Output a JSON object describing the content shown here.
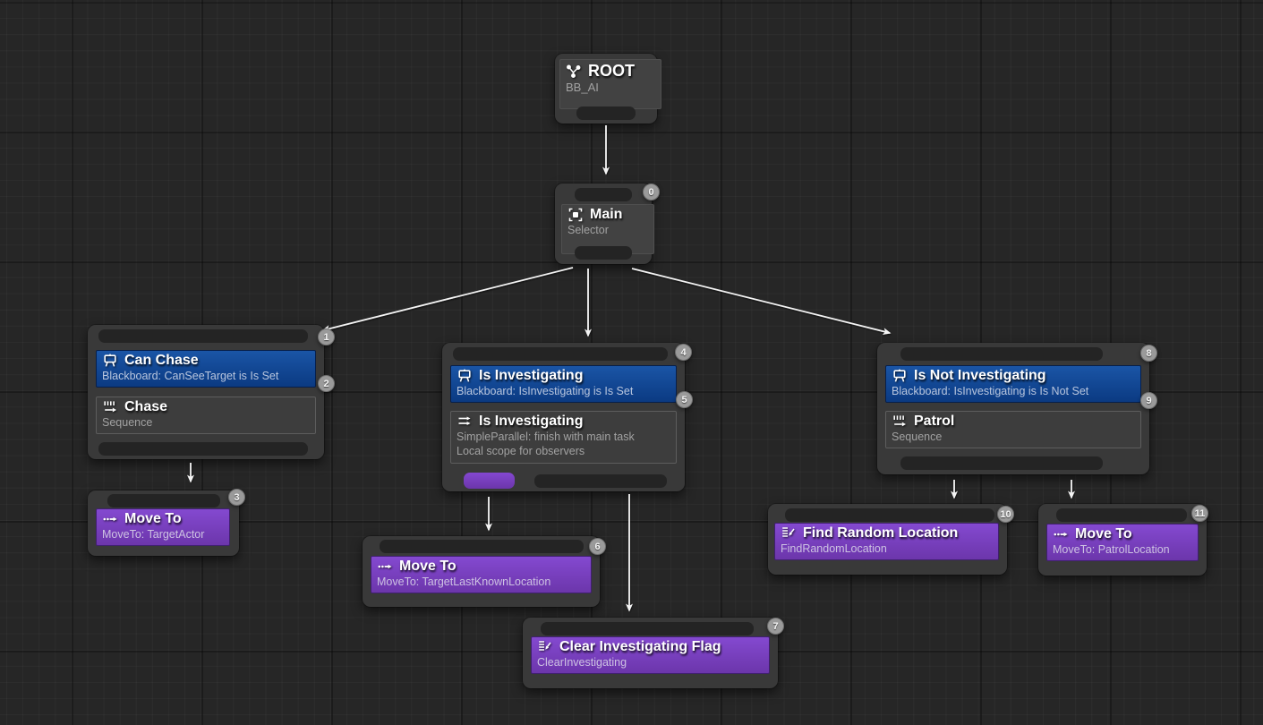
{
  "colors": {
    "background": "#262626",
    "node_gray": "#393939",
    "decorator_blue": "#11479a",
    "task_purple": "#7a3fc4",
    "wire": "#f2f2f2",
    "badge": "#9a9a9a"
  },
  "nodes": {
    "root": {
      "title": "ROOT",
      "subtitle": "BB_AI"
    },
    "main": {
      "badge": "0",
      "title": "Main",
      "subtitle": "Selector"
    },
    "chase": {
      "badge": "1",
      "decorator": {
        "badge": "2",
        "title": "Can Chase",
        "subtitle": "Blackboard: CanSeeTarget is Is Set"
      },
      "composite": {
        "title": "Chase",
        "subtitle": "Sequence"
      }
    },
    "move_to_target": {
      "badge": "3",
      "title": "Move To",
      "subtitle": "MoveTo: TargetActor"
    },
    "investigate": {
      "badge": "4",
      "decorator": {
        "badge": "5",
        "title": "Is Investigating",
        "subtitle": "Blackboard: IsInvestigating is Is Set"
      },
      "composite": {
        "title": "Is Investigating",
        "subtitle_line1": "SimpleParallel: finish with main task",
        "subtitle_line2": "Local scope for observers"
      }
    },
    "move_to_last_known": {
      "badge": "6",
      "title": "Move To",
      "subtitle": "MoveTo: TargetLastKnownLocation"
    },
    "clear_flag": {
      "badge": "7",
      "title": "Clear Investigating Flag",
      "subtitle": "ClearInvestigating"
    },
    "patrol": {
      "badge": "8",
      "decorator": {
        "badge": "9",
        "title": "Is Not Investigating",
        "subtitle": "Blackboard: IsInvestigating is Is Not Set"
      },
      "composite": {
        "title": "Patrol",
        "subtitle": "Sequence"
      }
    },
    "find_random": {
      "badge": "10",
      "title": "Find Random Location",
      "subtitle": "FindRandomLocation"
    },
    "move_to_patrol": {
      "badge": "11",
      "title": "Move To",
      "subtitle": "MoveTo: PatrolLocation"
    }
  }
}
